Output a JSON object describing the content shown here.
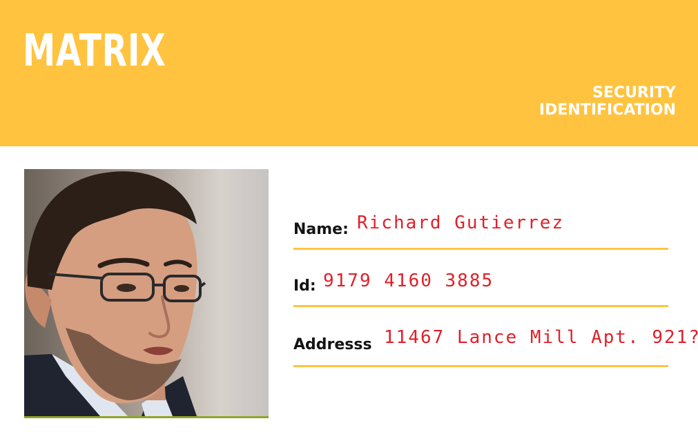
{
  "header": {
    "brand": "MATRIX",
    "card_type_line1": "SECURITY",
    "card_type_line2": "IDENTIFICATION",
    "background_color": "#FFC33F"
  },
  "fields": {
    "name": {
      "label": "Name:",
      "value": "Richard Gutierrez"
    },
    "id": {
      "label": "Id:",
      "value": "9179 4160 3885"
    },
    "address": {
      "label": "Addresss",
      "value": "11467 Lance Mill Apt. 921?"
    }
  },
  "accent_color": "#FFC33F",
  "value_color": "#E0202A"
}
